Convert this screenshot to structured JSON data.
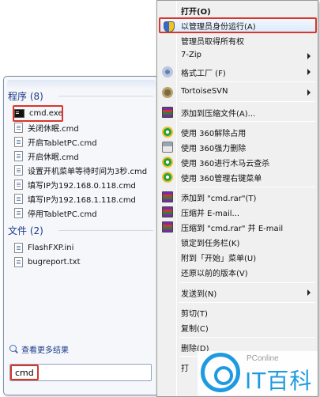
{
  "start_menu": {
    "programs": {
      "header": "程序 (8)",
      "items": [
        {
          "label": "cmd.exe",
          "icon": "cmd-icon"
        },
        {
          "label": "关闭休眠.cmd",
          "icon": "file-icon"
        },
        {
          "label": "开启TabletPC.cmd",
          "icon": "file-icon"
        },
        {
          "label": "开启休眠.cmd",
          "icon": "file-icon"
        },
        {
          "label": "设置开机菜单等待时间为3秒.cmd",
          "icon": "file-icon"
        },
        {
          "label": "填写IP为192.168.0.118.cmd",
          "icon": "file-icon"
        },
        {
          "label": "填写IP为192.168.1.118.cmd",
          "icon": "file-icon"
        },
        {
          "label": "停用TabletPC.cmd",
          "icon": "file-icon"
        }
      ]
    },
    "files": {
      "header": "文件 (2)",
      "items": [
        {
          "label": "FlashFXP.ini",
          "icon": "file-icon"
        },
        {
          "label": "bugreport.txt",
          "icon": "file-icon"
        }
      ]
    },
    "see_more": "查看更多结果",
    "search_value": "cmd"
  },
  "context_menu": {
    "items": [
      {
        "label": "打开(O)",
        "bold": true,
        "icon": ""
      },
      {
        "label": "以管理员身份运行(A)",
        "selected": true,
        "icon": "shield-icon"
      },
      {
        "label": "管理员取得所有权",
        "icon": ""
      },
      {
        "label": "7-Zip",
        "submenu": true,
        "icon": ""
      },
      {
        "label": "格式工厂 (F)",
        "submenu": true,
        "icon": "format-factory-icon"
      },
      {
        "label": "TortoiseSVN",
        "submenu": true,
        "icon": "tortoise-svn-icon"
      },
      {
        "label": "添加到压缩文件(A)...",
        "icon": "winrar-icon"
      },
      {
        "label": "使用 360解除占用",
        "icon": "360-icon"
      },
      {
        "label": "使用 360强力删除",
        "icon": "printer-icon"
      },
      {
        "label": "使用 360进行木马云查杀",
        "icon": "360-icon"
      },
      {
        "label": "使用 360管理右键菜单",
        "icon": "360-icon"
      },
      {
        "label": "添加到 \"cmd.rar\"(T)",
        "icon": "winrar-icon"
      },
      {
        "label": "压缩并 E-mail...",
        "icon": "winrar-icon"
      },
      {
        "label": "压缩到 \"cmd.rar\" 并 E-mail",
        "icon": "winrar-icon"
      },
      {
        "label": "锁定到任务栏(K)",
        "icon": ""
      },
      {
        "label": "附到「开始」菜单(U)",
        "icon": ""
      },
      {
        "label": "还原以前的版本(V)",
        "icon": ""
      },
      {
        "label": "发送到(N)",
        "submenu": true,
        "icon": ""
      },
      {
        "label": "剪切(T)",
        "icon": ""
      },
      {
        "label": "复制(C)",
        "icon": ""
      },
      {
        "label": "删除(D)",
        "icon": ""
      },
      {
        "label": "打",
        "icon": ""
      }
    ]
  },
  "watermark": {
    "brand": "PConline",
    "name": "IT百科"
  },
  "colors": {
    "highlight": "#d9352a",
    "link": "#1c3a8a",
    "watermark_blue": "#1e9be0"
  }
}
